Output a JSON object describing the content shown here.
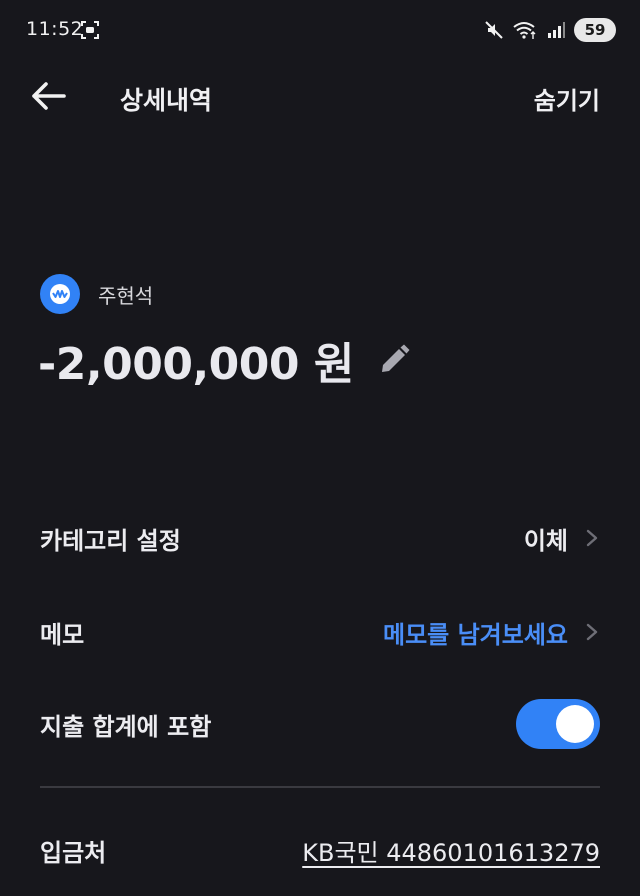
{
  "status_bar": {
    "time": "11:52",
    "battery": "59",
    "icons": [
      "screen-record-icon",
      "mute-icon",
      "wifi-icon",
      "signal-icon"
    ]
  },
  "header": {
    "title": "상세내역",
    "hide_label": "숨기기",
    "back_icon": "arrow-left-icon"
  },
  "transaction": {
    "account_name": "주현석",
    "amount": "-2,000,000 원",
    "edit_icon": "pencil-icon"
  },
  "details": {
    "category": {
      "label": "카테고리 설정",
      "value": "이체"
    },
    "memo": {
      "label": "메모",
      "placeholder": "메모를 남겨보세요"
    },
    "include_in_total": {
      "label": "지출 합계에 포함",
      "enabled": true
    },
    "deposit_to": {
      "label": "입금처",
      "value": "KB국민 44860101613279"
    }
  },
  "colors": {
    "background": "#17171c",
    "accent": "#3182f6",
    "link_blue": "#4a8ef7",
    "text": "#ececf0"
  }
}
